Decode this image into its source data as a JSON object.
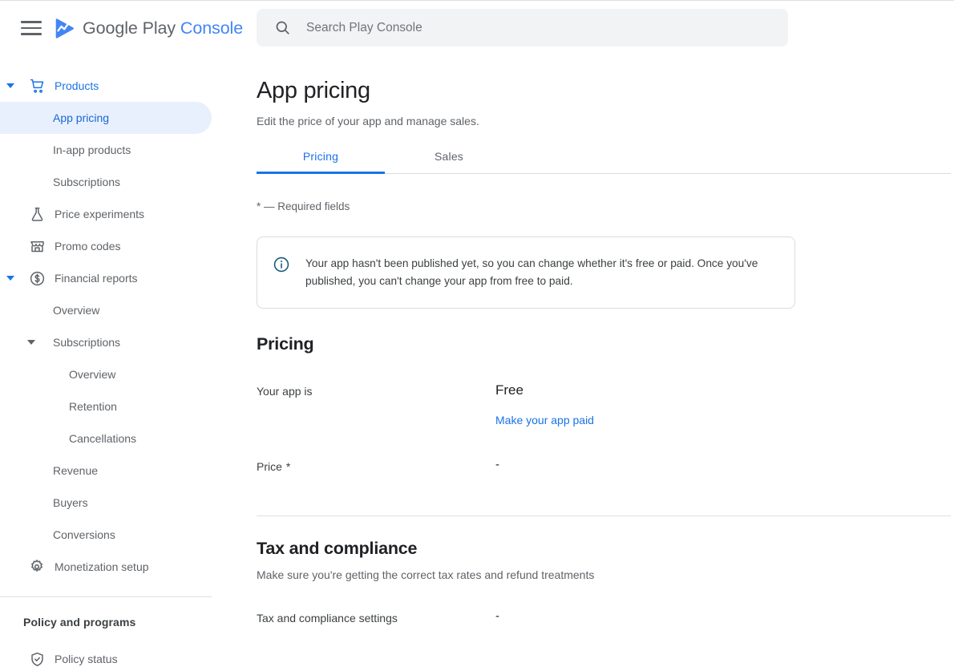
{
  "header": {
    "menu_icon": "hamburger-menu-icon",
    "logo_icon": "google-play-logo-icon",
    "brand_part1": "Google Play",
    "brand_part2": "Console"
  },
  "search": {
    "icon": "search-icon",
    "placeholder": "Search Play Console",
    "value": ""
  },
  "sidebar": {
    "items": [
      {
        "label": "Products",
        "level": 0,
        "icon": "shopping-cart-icon",
        "caret": true,
        "state": "blue"
      },
      {
        "label": "App pricing",
        "level": 1,
        "icon": "",
        "caret": false,
        "state": "active"
      },
      {
        "label": "In-app products",
        "level": 1,
        "icon": "",
        "caret": false,
        "state": "normal"
      },
      {
        "label": "Subscriptions",
        "level": 1,
        "icon": "",
        "caret": false,
        "state": "normal"
      },
      {
        "label": "Price experiments",
        "level": 0,
        "icon": "flask-icon",
        "caret": false,
        "state": "normal"
      },
      {
        "label": "Promo codes",
        "level": 0,
        "icon": "storefront-icon",
        "caret": false,
        "state": "normal"
      },
      {
        "label": "Financial reports",
        "level": 0,
        "icon": "dollar-circle-icon",
        "caret": true,
        "state": "normal"
      },
      {
        "label": "Overview",
        "level": 1,
        "icon": "",
        "caret": false,
        "state": "normal"
      },
      {
        "label": "Subscriptions",
        "level": 1,
        "icon": "",
        "caret": true,
        "state": "normal"
      },
      {
        "label": "Overview",
        "level": 2,
        "icon": "",
        "caret": false,
        "state": "normal"
      },
      {
        "label": "Retention",
        "level": 2,
        "icon": "",
        "caret": false,
        "state": "normal"
      },
      {
        "label": "Cancellations",
        "level": 2,
        "icon": "",
        "caret": false,
        "state": "normal"
      },
      {
        "label": "Revenue",
        "level": 1,
        "icon": "",
        "caret": false,
        "state": "normal"
      },
      {
        "label": "Buyers",
        "level": 1,
        "icon": "",
        "caret": false,
        "state": "normal"
      },
      {
        "label": "Conversions",
        "level": 1,
        "icon": "",
        "caret": false,
        "state": "normal"
      },
      {
        "label": "Monetization setup",
        "level": 0,
        "icon": "gear-icon",
        "caret": false,
        "state": "normal"
      }
    ],
    "section_title": "Policy and programs",
    "section_items": [
      {
        "label": "Policy status",
        "level": 0,
        "icon": "shield-check-icon",
        "caret": false,
        "state": "normal"
      }
    ]
  },
  "page": {
    "title": "App pricing",
    "subtitle": "Edit the price of your app and manage sales.",
    "tabs": [
      {
        "label": "Pricing",
        "active": true
      },
      {
        "label": "Sales",
        "active": false
      }
    ],
    "required_note": "* — Required fields",
    "info_banner": {
      "icon": "info-circle-icon",
      "text": "Your app hasn't been published yet, so you can change whether it's free or paid. Once you've published, you can't change your app from free to paid."
    },
    "pricing_section": {
      "title": "Pricing",
      "app_is_label": "Your app is",
      "app_is_value": "Free",
      "make_paid_link": "Make your app paid",
      "price_label": "Price",
      "price_star": "*",
      "price_value": "-"
    },
    "tax_section": {
      "title": "Tax and compliance",
      "subtitle": "Make sure you're getting the correct tax rates and refund treatments",
      "settings_label": "Tax and compliance settings",
      "settings_value": "-"
    }
  },
  "colors": {
    "accent_blue": "#1a73e8",
    "active_pill": "#e8f0fe",
    "active_text": "#1967d2",
    "text_primary": "#202124",
    "text_secondary": "#5f6368",
    "border": "#dadce0",
    "search_bg": "#f1f3f4"
  }
}
